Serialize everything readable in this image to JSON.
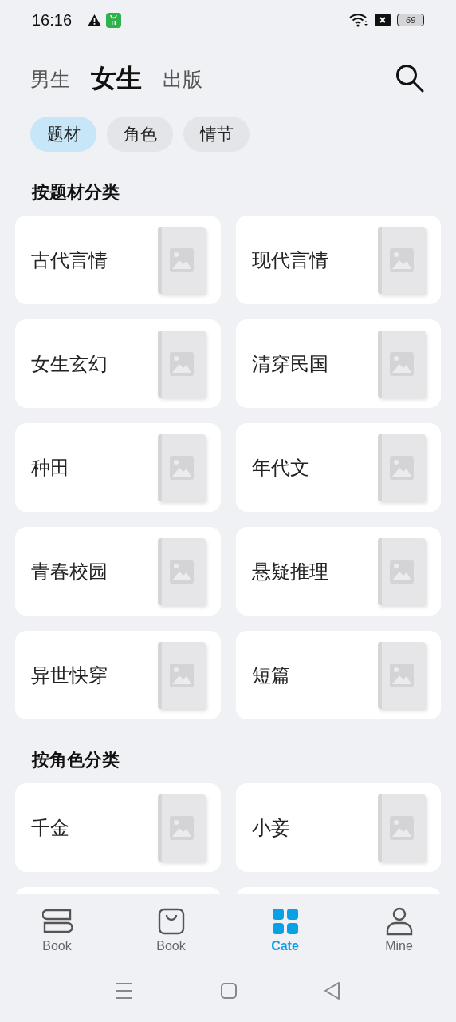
{
  "status_bar": {
    "time": "16:16",
    "battery": "69"
  },
  "top_tabs": [
    {
      "label": "男生",
      "selected": false
    },
    {
      "label": "女生",
      "selected": true
    },
    {
      "label": "出版",
      "selected": false
    }
  ],
  "filter_chips": [
    {
      "label": "题材",
      "selected": true
    },
    {
      "label": "角色",
      "selected": false
    },
    {
      "label": "情节",
      "selected": false
    }
  ],
  "sections": [
    {
      "title": "按题材分类",
      "items": [
        {
          "label": "古代言情"
        },
        {
          "label": "现代言情"
        },
        {
          "label": "女生玄幻"
        },
        {
          "label": "清穿民国"
        },
        {
          "label": "种田"
        },
        {
          "label": "年代文"
        },
        {
          "label": "青春校园"
        },
        {
          "label": "悬疑推理"
        },
        {
          "label": "异世快穿"
        },
        {
          "label": "短篇"
        }
      ]
    },
    {
      "title": "按角色分类",
      "items": [
        {
          "label": "千金"
        },
        {
          "label": "小妾"
        }
      ]
    }
  ],
  "bottom_nav": [
    {
      "label": "Book",
      "kind": "books",
      "selected": false
    },
    {
      "label": "Book",
      "kind": "bag",
      "selected": false
    },
    {
      "label": "Cate",
      "kind": "grid",
      "selected": true
    },
    {
      "label": "Mine",
      "kind": "person",
      "selected": false
    }
  ]
}
